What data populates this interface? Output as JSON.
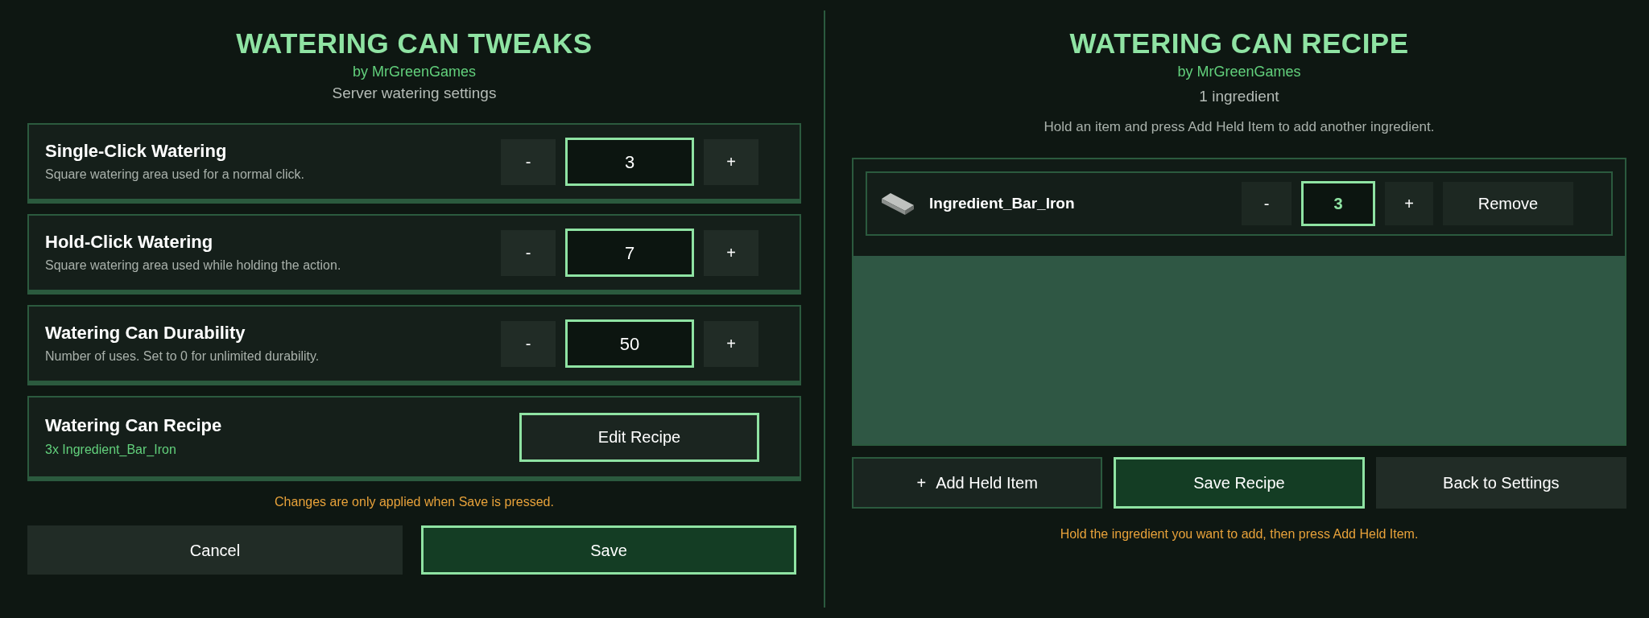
{
  "settings_panel": {
    "title": "WATERING CAN TWEAKS",
    "author": "by MrGreenGames",
    "subtitle": "Server watering settings",
    "settings": [
      {
        "kind": "stepper",
        "title": "Single-Click Watering",
        "description": "Square watering area used for a normal click.",
        "decrement": "-",
        "value": "3",
        "increment": "+"
      },
      {
        "kind": "stepper",
        "title": "Hold-Click Watering",
        "description": "Square watering area used while holding the action.",
        "decrement": "-",
        "value": "7",
        "increment": "+"
      },
      {
        "kind": "stepper",
        "title": "Watering Can Durability",
        "description": "Number of uses. Set to 0 for unlimited durability.",
        "decrement": "-",
        "value": "50",
        "increment": "+"
      },
      {
        "kind": "recipe",
        "title": "Watering Can Recipe",
        "summary": "3x Ingredient_Bar_Iron",
        "button": "Edit Recipe"
      }
    ],
    "notice": "Changes are only applied when Save is pressed.",
    "buttons": [
      {
        "kind": "secondary",
        "label": "Cancel"
      },
      {
        "kind": "primary",
        "label": "Save"
      }
    ]
  },
  "recipe_panel": {
    "title": "WATERING CAN RECIPE",
    "author": "by MrGreenGames",
    "count": "1 ingredient",
    "instructions": "Hold an item and press Add Held Item to add another ingredient.",
    "ingredients": [
      {
        "name": "Ingredient_Bar_Iron",
        "decrement": "-",
        "value": "3",
        "increment": "+",
        "remove": "Remove"
      }
    ],
    "buttons": [
      {
        "kind": "outlined",
        "prefix": "+",
        "label": "Add Held Item"
      },
      {
        "kind": "primary",
        "label": "Save Recipe"
      },
      {
        "kind": "secondary",
        "label": "Back to Settings"
      }
    ],
    "hint": "Hold the ingredient you want to add, then press Add Held Item."
  }
}
